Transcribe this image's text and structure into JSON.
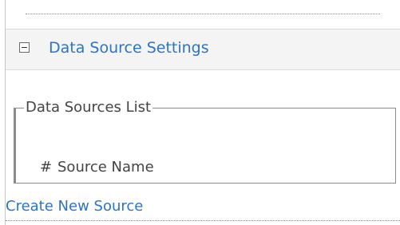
{
  "section": {
    "title": "Data Source Settings",
    "toggle_icon": "minus-collapse-icon"
  },
  "data_sources_list": {
    "legend": "Data Sources List",
    "columns": [
      "#",
      "Source Name"
    ]
  },
  "actions": {
    "create_new_source": "Create New Source"
  },
  "colors": {
    "link": "#2b74c7",
    "header_background": "#f4f4f4",
    "text": "#444444",
    "border": "#8a8a8a"
  }
}
